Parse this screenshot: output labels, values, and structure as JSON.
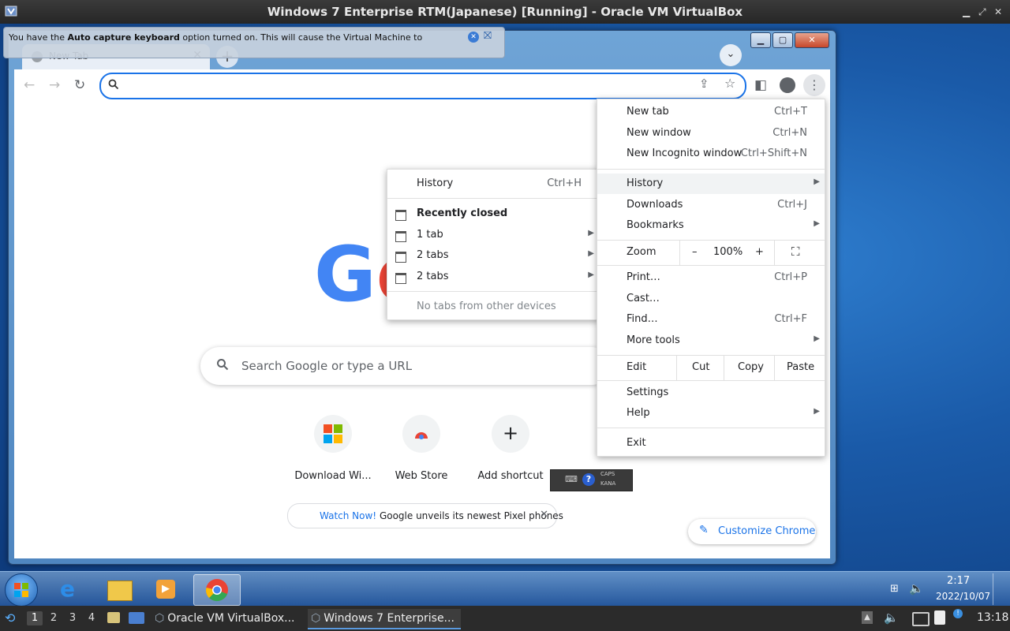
{
  "host": {
    "title": "Windows 7 Enterprise RTM(Japanese) [Running] - Oracle VM VirtualBox",
    "capture_notice": {
      "pre": "You have the ",
      "bold": "Auto capture keyboard",
      "post": " option turned on. This will cause the Virtual Machine to"
    },
    "panel": {
      "workspaces": [
        "1",
        "2",
        "3",
        "4"
      ],
      "tasks": [
        "Oracle VM VirtualBox...",
        "Windows 7 Enterprise..."
      ],
      "clock": "13:18"
    }
  },
  "chrome": {
    "tab_title": "New Tab",
    "new_tab_symbol": "+",
    "omnibox_value": "",
    "ntp": {
      "logo": "Go",
      "search_placeholder": "Search Google or type a URL",
      "shortcuts": [
        "Download Wi...",
        "Web Store",
        "Add shortcut"
      ],
      "promo_link": "Watch Now!",
      "promo_text": " Google unveils its newest Pixel phones",
      "customize": "Customize Chrome"
    },
    "main_menu": {
      "new_tab": {
        "label": "New tab",
        "shortcut": "Ctrl+T"
      },
      "new_window": {
        "label": "New window",
        "shortcut": "Ctrl+N"
      },
      "new_incognito": {
        "label": "New Incognito window",
        "shortcut": "Ctrl+Shift+N"
      },
      "history": {
        "label": "History"
      },
      "downloads": {
        "label": "Downloads",
        "shortcut": "Ctrl+J"
      },
      "bookmarks": {
        "label": "Bookmarks"
      },
      "zoom": {
        "label": "Zoom",
        "minus": "–",
        "value": "100%",
        "plus": "+"
      },
      "print": {
        "label": "Print…",
        "shortcut": "Ctrl+P"
      },
      "cast": {
        "label": "Cast…"
      },
      "find": {
        "label": "Find…",
        "shortcut": "Ctrl+F"
      },
      "more_tools": {
        "label": "More tools"
      },
      "edit": {
        "label": "Edit",
        "cut": "Cut",
        "copy": "Copy",
        "paste": "Paste"
      },
      "settings": {
        "label": "Settings"
      },
      "help": {
        "label": "Help"
      },
      "exit": {
        "label": "Exit"
      }
    },
    "history_menu": {
      "history": {
        "label": "History",
        "shortcut": "Ctrl+H"
      },
      "recently_closed": "Recently closed",
      "items": [
        "1 tab",
        "2 tabs",
        "2 tabs"
      ],
      "no_tabs": "No tabs from other devices"
    }
  },
  "win7": {
    "clock_time": "2:17",
    "clock_date": "2022/10/07",
    "ime_caps": "CAPS",
    "ime_kana": "KANA"
  },
  "colors": {
    "accent": "#1a73e8",
    "google_blue": "#4285f4",
    "google_red": "#ea4335"
  }
}
